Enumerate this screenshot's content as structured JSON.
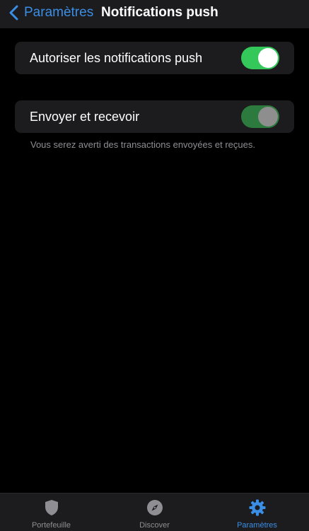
{
  "nav": {
    "back_label": "Paramètres",
    "title": "Notifications push"
  },
  "settings": {
    "allow_push": {
      "label": "Autoriser les notifications push",
      "enabled": true
    },
    "send_receive": {
      "label": "Envoyer et recevoir",
      "enabled": true,
      "disabled_state": true,
      "footnote": "Vous serez averti des transactions envoyées et reçues."
    }
  },
  "tab_bar": {
    "tabs": [
      {
        "label": "Portefeuille",
        "icon": "shield-icon",
        "active": false
      },
      {
        "label": "Discover",
        "icon": "compass-icon",
        "active": false
      },
      {
        "label": "Paramètres",
        "icon": "gear-icon",
        "active": true
      }
    ]
  },
  "colors": {
    "accent": "#3a8ee6",
    "toggle_on": "#34c759",
    "toggle_on_disabled": "#2c7a3d",
    "background": "#000000",
    "surface": "#1c1c1e",
    "secondary_text": "#8e8e93"
  }
}
